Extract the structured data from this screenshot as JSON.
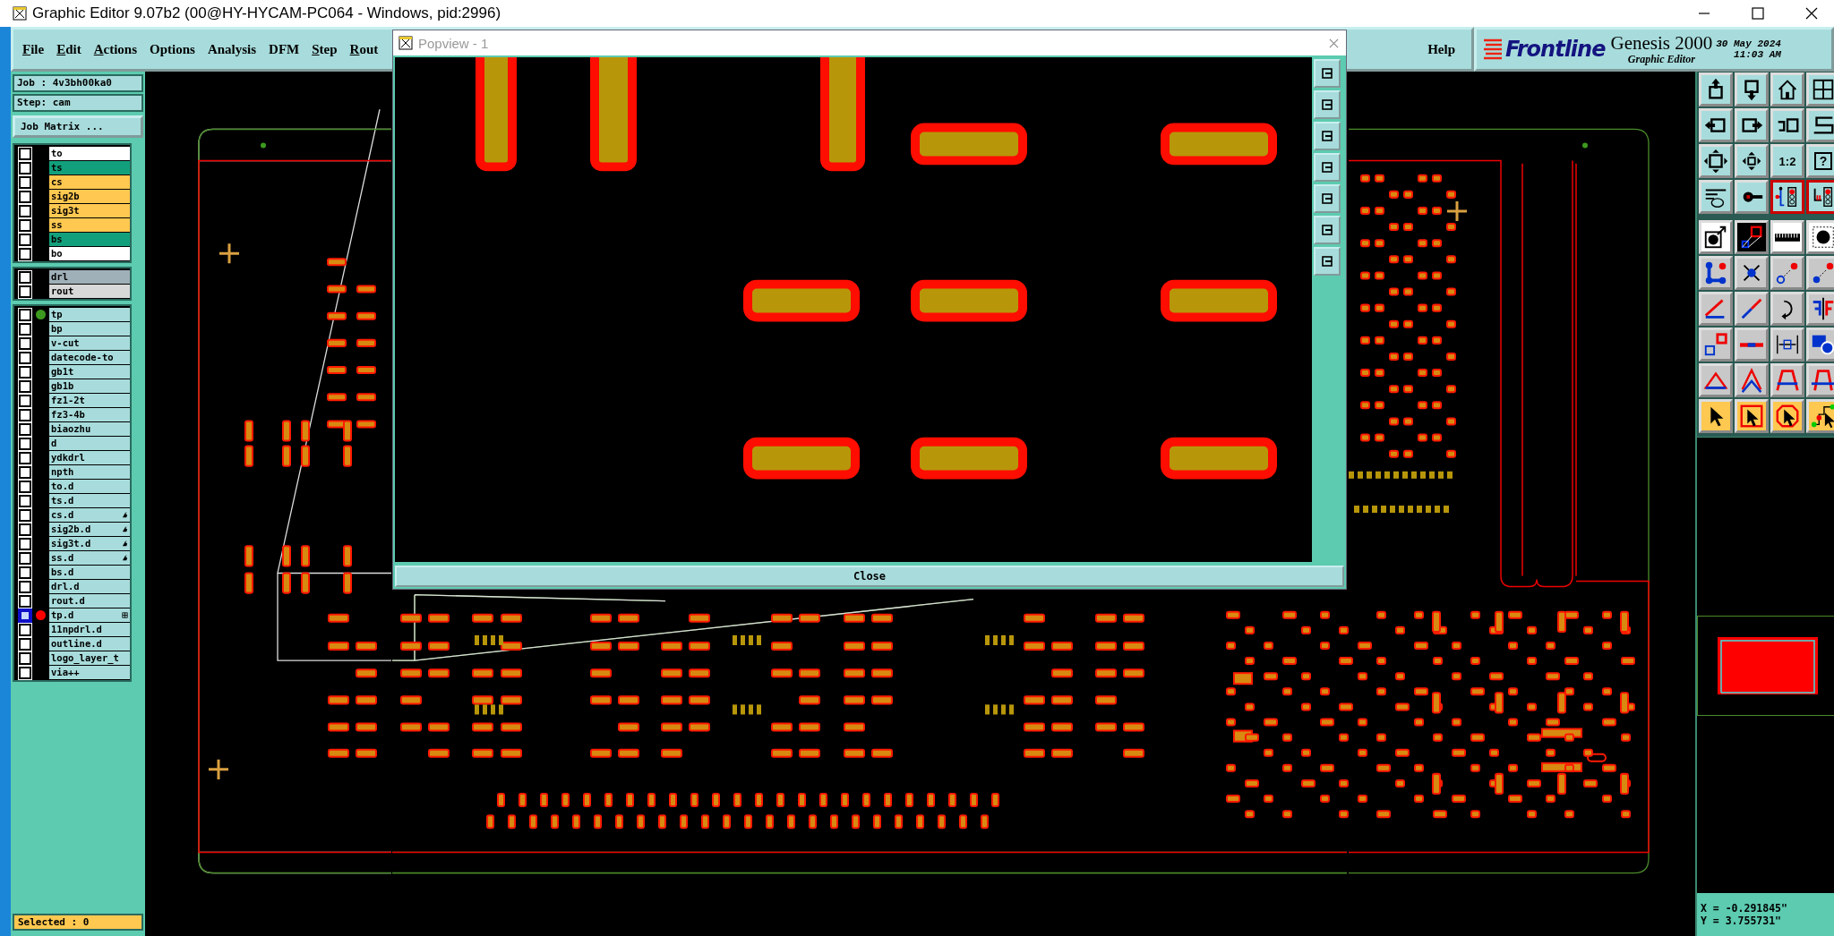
{
  "window": {
    "title": "Graphic Editor 9.07b2 (00@HY-HYCAM-PC064 - Windows, pid:2996)"
  },
  "menu": [
    {
      "label": "File",
      "underlined": true
    },
    {
      "label": "Edit",
      "underlined": true
    },
    {
      "label": "Actions",
      "underlined": true
    },
    {
      "label": "Options",
      "underlined": false
    },
    {
      "label": "Analysis",
      "underlined": false
    },
    {
      "label": "DFM",
      "underlined": false
    },
    {
      "label": "Step",
      "underlined": true
    },
    {
      "label": "Rout",
      "underlined": true
    }
  ],
  "help_menu": {
    "label": "Help"
  },
  "brand": {
    "logo": "Frontline",
    "product": "Genesis 2000",
    "subtitle": "Graphic Editor",
    "date": "30 May 2024",
    "time": "11:03 AM"
  },
  "job_panel": {
    "job": "Job : 4v3bh00ka0",
    "step": "Step: cam",
    "matrix_button": "Job Matrix ...",
    "selected": "Selected : 0",
    "layer_groups": [
      {
        "layers": [
          {
            "name": "to",
            "color": "#ffffff",
            "checked": false,
            "selected": false
          },
          {
            "name": "ts",
            "color": "#12a07c",
            "checked": false,
            "selected": false
          },
          {
            "name": "cs",
            "color": "#ffc850",
            "checked": false,
            "selected": false
          },
          {
            "name": "sig2b",
            "color": "#ffc850",
            "checked": false,
            "selected": false
          },
          {
            "name": "sig3t",
            "color": "#ffc850",
            "checked": false,
            "selected": false
          },
          {
            "name": "ss",
            "color": "#ffc850",
            "checked": false,
            "selected": false
          },
          {
            "name": "bs",
            "color": "#12a07c",
            "checked": false,
            "selected": false
          },
          {
            "name": "bo",
            "color": "#ffffff",
            "checked": false,
            "selected": false
          }
        ]
      },
      {
        "layers": [
          {
            "name": "drl",
            "color": "#a0b0b8",
            "checked": false,
            "selected": false
          },
          {
            "name": "rout",
            "color": "#d8d8d8",
            "checked": false,
            "selected": false
          }
        ]
      },
      {
        "layers": [
          {
            "name": "tp",
            "color": "#a8dcdc",
            "checked": false,
            "selected": false,
            "dot": {
              "color": "#3c9a1e"
            }
          },
          {
            "name": "bp",
            "color": "#a8dcdc",
            "checked": false,
            "selected": false
          },
          {
            "name": "v-cut",
            "color": "#a8dcdc",
            "checked": false,
            "selected": false
          },
          {
            "name": "datecode-to",
            "color": "#a8dcdc",
            "checked": false,
            "selected": false
          },
          {
            "name": "gb1t",
            "color": "#a8dcdc",
            "checked": false,
            "selected": false
          },
          {
            "name": "gb1b",
            "color": "#a8dcdc",
            "checked": false,
            "selected": false
          },
          {
            "name": "fz1-2t",
            "color": "#a8dcdc",
            "checked": false,
            "selected": false
          },
          {
            "name": "fz3-4b",
            "color": "#a8dcdc",
            "checked": false,
            "selected": false
          },
          {
            "name": "biaozhu",
            "color": "#a8dcdc",
            "checked": false,
            "selected": false
          },
          {
            "name": "d",
            "color": "#a8dcdc",
            "checked": false,
            "selected": false
          },
          {
            "name": "ydkdrl",
            "color": "#a8dcdc",
            "checked": false,
            "selected": false
          },
          {
            "name": "npth",
            "color": "#a8dcdc",
            "checked": false,
            "selected": false
          },
          {
            "name": "to.d",
            "color": "#a8dcdc",
            "checked": false,
            "selected": false
          },
          {
            "name": "ts.d",
            "color": "#a8dcdc",
            "checked": false,
            "selected": false
          },
          {
            "name": "cs.d",
            "color": "#a8dcdc",
            "checked": false,
            "selected": false,
            "kind": "drill"
          },
          {
            "name": "sig2b.d",
            "color": "#a8dcdc",
            "checked": false,
            "selected": false,
            "kind": "drill"
          },
          {
            "name": "sig3t.d",
            "color": "#a8dcdc",
            "checked": false,
            "selected": false,
            "kind": "drill"
          },
          {
            "name": "ss.d",
            "color": "#a8dcdc",
            "checked": false,
            "selected": false,
            "kind": "drill"
          },
          {
            "name": "bs.d",
            "color": "#a8dcdc",
            "checked": false,
            "selected": false
          },
          {
            "name": "drl.d",
            "color": "#a8dcdc",
            "checked": false,
            "selected": false
          },
          {
            "name": "rout.d",
            "color": "#a8dcdc",
            "checked": false,
            "selected": false
          },
          {
            "name": "tp.d",
            "color": "#a8dcdc",
            "checked": false,
            "selected": true,
            "dot": {
              "color": "#ff0000"
            },
            "kind": "grid"
          },
          {
            "name": "11npdrl.d",
            "color": "#a8dcdc",
            "checked": false,
            "selected": false
          },
          {
            "name": "outline.d",
            "color": "#a8dcdc",
            "checked": false,
            "selected": false
          },
          {
            "name": "logo_layer_t",
            "color": "#a8dcdc",
            "checked": false,
            "selected": false
          },
          {
            "name": "via++",
            "color": "#a8dcdc",
            "checked": false,
            "selected": false
          }
        ]
      }
    ]
  },
  "toolbar": {
    "scale_label": "1:2",
    "help_label": "?"
  },
  "popview": {
    "title": "Popview - 1",
    "close_button": "Close"
  },
  "coordinates": {
    "x": "X = -0.291845\"",
    "y": "Y = 3.755731\""
  }
}
